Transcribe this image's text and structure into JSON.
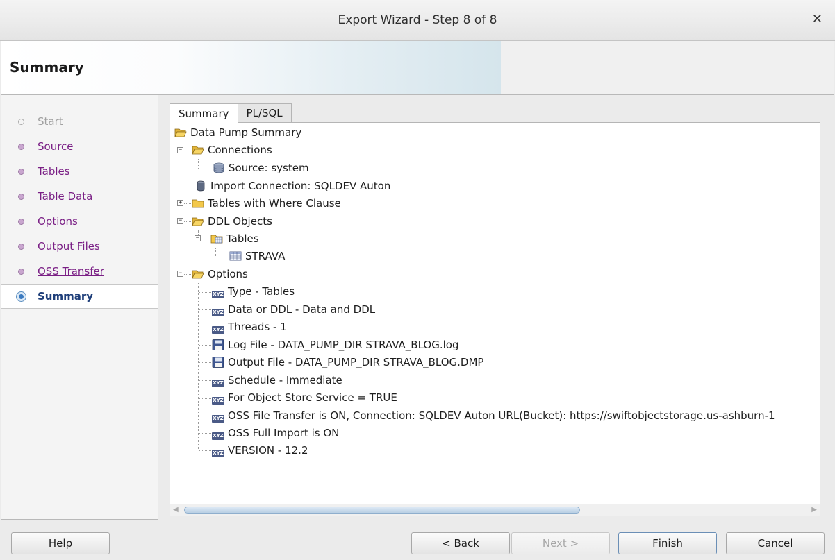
{
  "window": {
    "title": "Export Wizard - Step 8 of 8",
    "close_glyph": "✕"
  },
  "header": {
    "heading": "Summary"
  },
  "nav": {
    "items": [
      {
        "label": "Start",
        "state": "disabled"
      },
      {
        "label": "Source",
        "state": "link"
      },
      {
        "label": "Tables",
        "state": "link"
      },
      {
        "label": "Table Data",
        "state": "link"
      },
      {
        "label": "Options",
        "state": "link"
      },
      {
        "label": "Output Files",
        "state": "link"
      },
      {
        "label": "OSS Transfer",
        "state": "link"
      },
      {
        "label": "Summary",
        "state": "active"
      }
    ]
  },
  "tabs": [
    {
      "label": "Summary",
      "active": true
    },
    {
      "label": "PL/SQL",
      "active": false
    }
  ],
  "tree": {
    "root": "Data Pump Summary",
    "connections": {
      "label": "Connections",
      "source": "Source: system"
    },
    "import_connection": "Import Connection: SQLDEV Auton",
    "tables_where": "Tables with Where Clause",
    "ddl_objects": {
      "label": "DDL Objects",
      "tables": "Tables",
      "table_name": "STRAVA"
    },
    "options": {
      "label": "Options",
      "items": [
        "Type - Tables",
        "Data or DDL - Data and DDL",
        "Threads - 1",
        "Log File - DATA_PUMP_DIR STRAVA_BLOG.log",
        "Output File - DATA_PUMP_DIR STRAVA_BLOG.DMP",
        "Schedule - Immediate",
        "For Object Store Service = TRUE",
        "OSS File Transfer is ON, Connection: SQLDEV Auton URL(Bucket): https://swiftobjectstorage.us-ashburn-1",
        "OSS Full Import is ON",
        "VERSION - 12.2"
      ]
    },
    "icon_text": "XYZ"
  },
  "buttons": {
    "help": {
      "mnemonic": "H",
      "rest": "elp"
    },
    "back": {
      "prefix": "< ",
      "mnemonic": "B",
      "rest": "ack"
    },
    "next": {
      "label": "Next >"
    },
    "finish": {
      "mnemonic": "F",
      "rest": "inish"
    },
    "cancel": {
      "label": "Cancel"
    }
  },
  "colors": {
    "link": "#7a1f85",
    "active_nav": "#1f3f7a",
    "folder": "#f3c84a",
    "xyz_icon": "#4a5a86"
  }
}
